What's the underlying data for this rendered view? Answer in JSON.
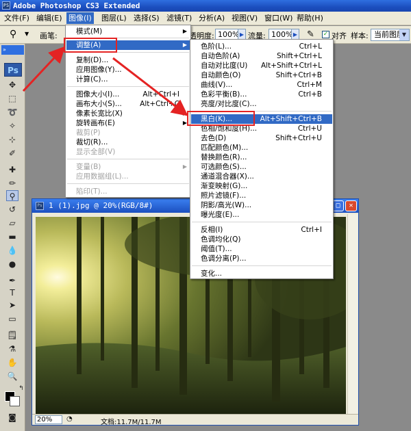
{
  "app": {
    "title": "Adobe Photoshop CS3 Extended",
    "logo": "PS"
  },
  "menubar": {
    "items": [
      "文件(F)",
      "编辑(E)",
      "图像(I)",
      "图层(L)",
      "选择(S)",
      "滤镜(T)",
      "分析(A)",
      "视图(V)",
      "窗口(W)",
      "帮助(H)"
    ],
    "active": "图像(I)"
  },
  "options": {
    "brush_label": "画笔:",
    "opacity_label": "透明度:",
    "opacity_value": "100%",
    "flow_label": "流量:",
    "flow_value": "100%",
    "align_label": "对齐",
    "sample_label": "样本:",
    "sample_value": "当前图层"
  },
  "toolbox": {
    "logo": "Ps",
    "grip": "»"
  },
  "image_menu": {
    "items": [
      {
        "label": "模式(M)",
        "sub": "▶"
      },
      {
        "label": "调整(A)",
        "sub": "▶"
      },
      {
        "label": "复制(D)..."
      },
      {
        "label": "应用图像(Y)..."
      },
      {
        "label": "计算(C)..."
      },
      {
        "label": "图像大小(I)...",
        "shortcut": "Alt+Ctrl+I"
      },
      {
        "label": "画布大小(S)...",
        "shortcut": "Alt+Ctrl+C"
      },
      {
        "label": "像素长宽比(X)",
        "sub": "▶"
      },
      {
        "label": "旋转画布(E)",
        "sub": "▶"
      },
      {
        "label": "裁剪(P)"
      },
      {
        "label": "裁切(R)..."
      },
      {
        "label": "显示全部(V)"
      },
      {
        "label": "变量(B)",
        "sub": "▶"
      },
      {
        "label": "应用数据组(L)..."
      },
      {
        "label": "陷印(T)..."
      }
    ]
  },
  "adjust_menu": {
    "items": [
      {
        "label": "色阶(L)...",
        "shortcut": "Ctrl+L"
      },
      {
        "label": "自动色阶(A)",
        "shortcut": "Shift+Ctrl+L"
      },
      {
        "label": "自动对比度(U)",
        "shortcut": "Alt+Shift+Ctrl+L"
      },
      {
        "label": "自动颜色(O)",
        "shortcut": "Shift+Ctrl+B"
      },
      {
        "label": "曲线(V)...",
        "shortcut": "Ctrl+M"
      },
      {
        "label": "色彩平衡(B)...",
        "shortcut": "Ctrl+B"
      },
      {
        "label": "亮度/对比度(C)..."
      },
      {
        "label": "黑白(K)...",
        "shortcut": "Alt+Shift+Ctrl+B"
      },
      {
        "label": "色相/饱和度(H)...",
        "shortcut": "Ctrl+U"
      },
      {
        "label": "去色(D)",
        "shortcut": "Shift+Ctrl+U"
      },
      {
        "label": "匹配颜色(M)..."
      },
      {
        "label": "替换颜色(R)..."
      },
      {
        "label": "可选颜色(S)..."
      },
      {
        "label": "通道混合器(X)..."
      },
      {
        "label": "渐变映射(G)..."
      },
      {
        "label": "照片滤镜(F)..."
      },
      {
        "label": "阴影/高光(W)..."
      },
      {
        "label": "曝光度(E)..."
      },
      {
        "label": "反相(I)",
        "shortcut": "Ctrl+I"
      },
      {
        "label": "色调均化(Q)"
      },
      {
        "label": "阈值(T)..."
      },
      {
        "label": "色调分离(P)..."
      },
      {
        "label": "变化..."
      }
    ]
  },
  "document": {
    "title": "1 (1).jpg @ 20%(RGB/8#)",
    "zoom": "20%",
    "doc_info": "文档:11.7M/11.7M"
  },
  "colors": {
    "accent": "#316ac5",
    "annotation": "#e42323"
  }
}
